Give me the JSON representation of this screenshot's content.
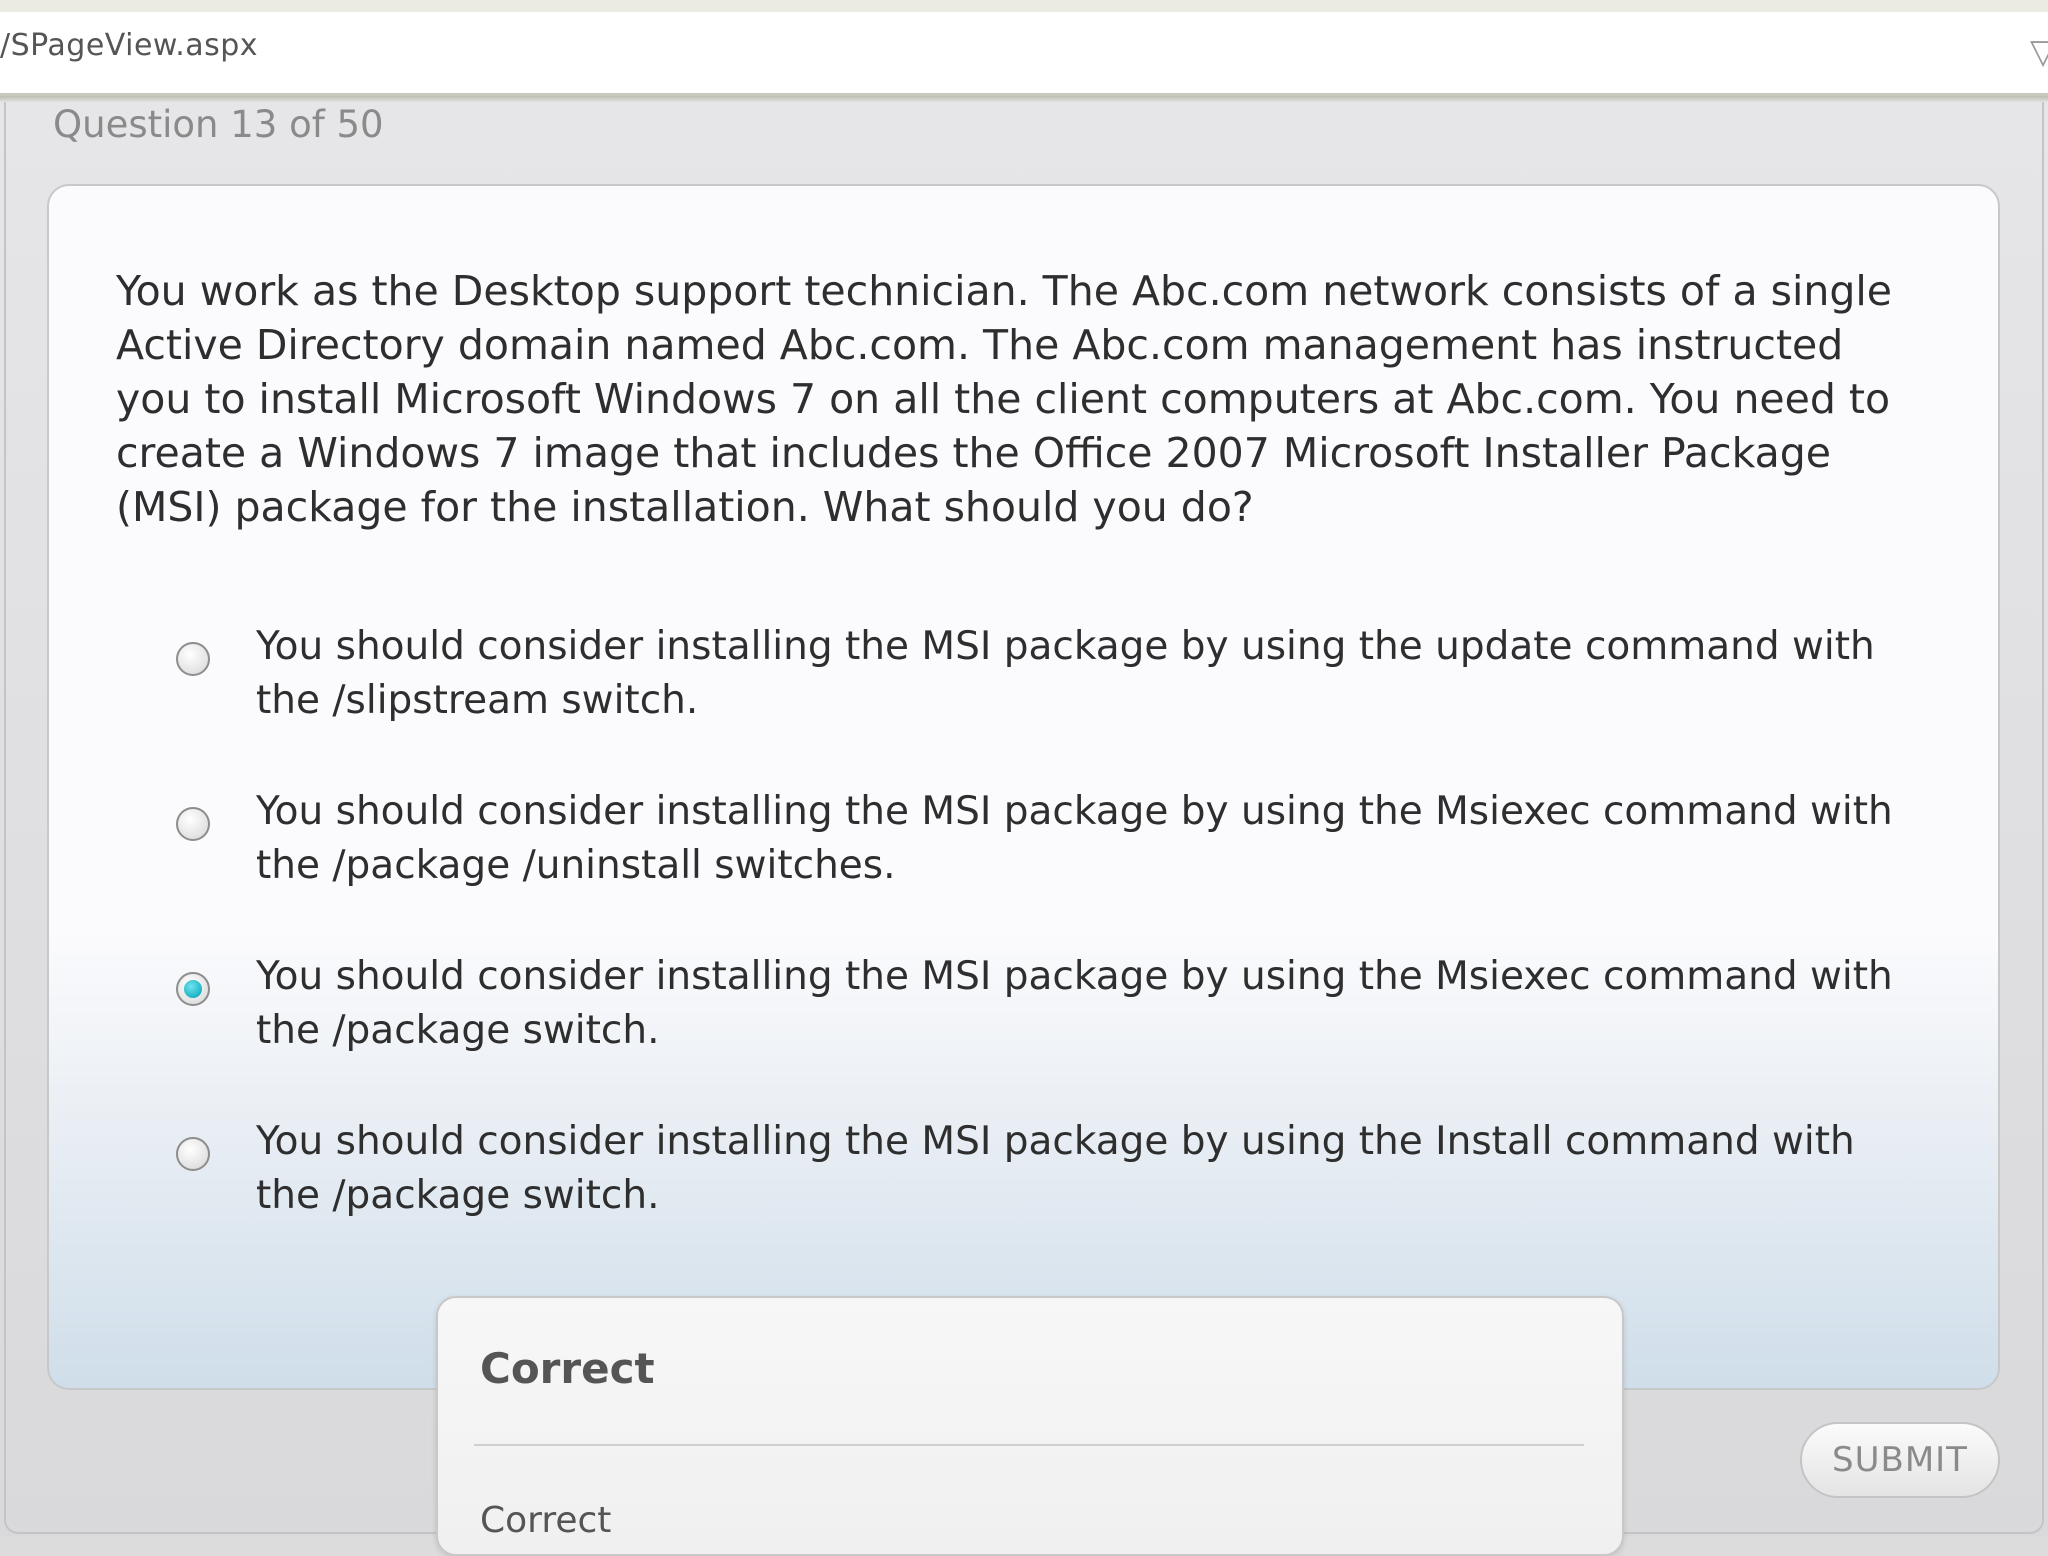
{
  "browser": {
    "address": "/SPageView.aspx",
    "address_icon": "filter-icon"
  },
  "exam": {
    "counter": "Question 13 of 50",
    "question": "You work as the Desktop support technician. The Abc.com network consists of a single Active Directory domain named Abc.com. The Abc.com management has instructed you to install Microsoft Windows 7 on all the client computers at Abc.com. You need to create a Windows 7 image that includes the Office 2007 Microsoft Installer Package (MSI) package for the installation. What should you do?",
    "options": [
      {
        "label": "You should consider installing the MSI package by using the update command with the /slipstream switch.",
        "selected": false
      },
      {
        "label": "You should consider installing the MSI package by using the Msiexec command with the /package /uninstall switches.",
        "selected": false
      },
      {
        "label": "You should consider installing the MSI package by using the Msiexec command with the /package switch.",
        "selected": true
      },
      {
        "label": "You should consider installing the MSI package by using the Install command with the /package switch.",
        "selected": false
      }
    ],
    "submit_label": "SUBMIT",
    "selected_color": "#1fb3c6"
  },
  "feedback": {
    "title": "Correct",
    "body": "Correct"
  }
}
